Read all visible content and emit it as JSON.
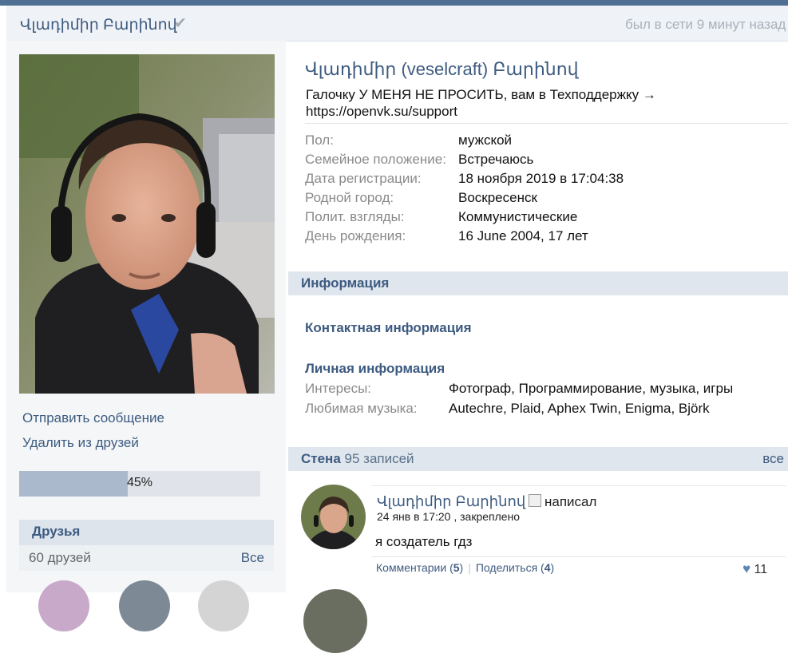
{
  "header": {
    "name": "Վլադիմիր Բարինով",
    "verified_icon": "checkmark-icon",
    "online_status": "был в сети 9 минут назад"
  },
  "profile": {
    "full_name": "Վլադիմիր (veselcraft) Բարինով",
    "status": "Галочку У МЕНЯ НЕ ПРОСИТЬ, вам в Техподдержку → https://openvk.su/support",
    "fields": [
      {
        "label": "Пол:",
        "value": "мужской"
      },
      {
        "label": "Семейное положение:",
        "value": "Встречаюсь"
      },
      {
        "label": "Дата регистрации:",
        "value": "18 ноября 2019 в 17:04:38"
      },
      {
        "label": "Родной город:",
        "value": "Воскресенск"
      },
      {
        "label": "Полит. взгляды:",
        "value": "Коммунистические"
      },
      {
        "label": "День рождения:",
        "value": "16 June 2004, 17 лет"
      }
    ]
  },
  "sidebar": {
    "send_message": "Отправить сообщение",
    "remove_friend": "Удалить из друзей",
    "progress_label": "45%",
    "progress_value": 45,
    "friends_title": "Друзья",
    "friends_count": "60 друзей",
    "friends_all": "Все"
  },
  "info": {
    "title": "Информация",
    "contact_title": "Контактная информация",
    "personal_title": "Личная информация",
    "rows": [
      {
        "label": "Интересы:",
        "value": "Фотограф, Программирование, музыка, игры"
      },
      {
        "label": "Любимая музыка:",
        "value": "Autechre, Plaid, Aphex Twin, Enigma, Björk"
      }
    ]
  },
  "wall": {
    "title": "Стена",
    "count": "95 записей",
    "all": "все"
  },
  "post": {
    "author": "Վլադիմիր Բարինով",
    "wrote": "написал",
    "meta": "24 янв в 17:20 , закреплено",
    "text": "я создатель гдз",
    "comments_label": "Комментарии",
    "comments_count": "5",
    "share_label": "Поделиться",
    "share_count": "4",
    "likes": "11",
    "like_icon": "heart-icon"
  },
  "colors": {
    "accent": "#3d5b80",
    "bar": "#dfe6ee",
    "progress_fill": "#aab9cc"
  }
}
